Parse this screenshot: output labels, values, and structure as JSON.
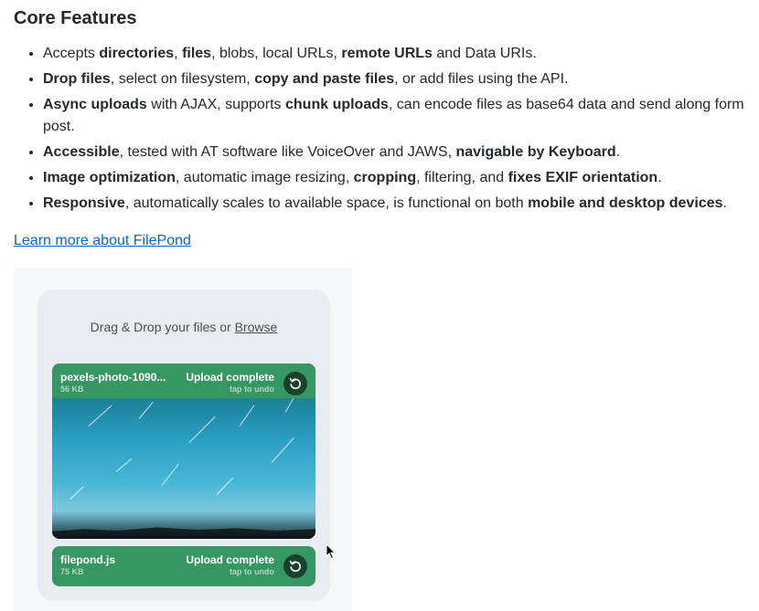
{
  "section": {
    "title": "Core Features"
  },
  "features": [
    [
      "Accepts ",
      "directories",
      ", ",
      "files",
      ", blobs, local URLs, ",
      "remote URLs",
      " and Data URIs."
    ],
    [
      "",
      "Drop files",
      ", select on filesystem, ",
      "copy and paste files",
      ", or add files using the API."
    ],
    [
      "",
      "Async uploads",
      " with AJAX, supports ",
      "chunk uploads",
      ", can encode files as base64 data and send along form post."
    ],
    [
      "",
      "Accessible",
      ", tested with AT software like VoiceOver and JAWS, ",
      "navigable by Keyboard",
      "."
    ],
    [
      "",
      "Image optimization",
      ", automatic image resizing, ",
      "cropping",
      ", filtering, and ",
      "fixes EXIF orientation",
      "."
    ],
    [
      "",
      "Responsive",
      ", automatically scales to available space, is functional on both ",
      "mobile and desktop devices",
      "."
    ]
  ],
  "link": {
    "text": "Learn more about FilePond"
  },
  "filepond": {
    "label_prefix": "Drag & Drop your files or ",
    "label_browse": "Browse",
    "items": [
      {
        "name": "pexels-photo-1090...",
        "size": "56 KB",
        "status": "Upload complete",
        "sub": "tap to undo"
      },
      {
        "name": "filepond.js",
        "size": "75 KB",
        "status": "Upload complete",
        "sub": "tap to undo"
      }
    ]
  },
  "colors": {
    "success_green": "#369763",
    "link_blue": "#0366d6",
    "panel_bg": "#e9ecf0"
  },
  "icons": {
    "undo": "undo-icon",
    "cursor": "mouse-cursor-icon"
  }
}
